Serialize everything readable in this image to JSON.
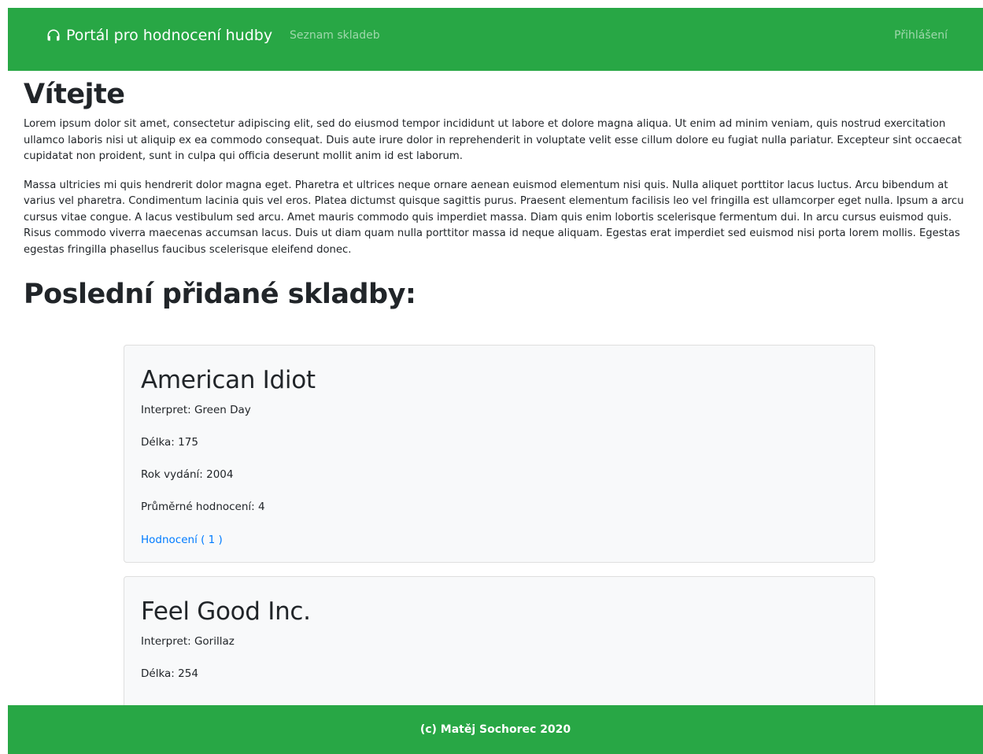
{
  "navbar": {
    "brand_text": "Portál pro hodnocení hudby",
    "brand_icon": "headphones-icon",
    "links": [
      "Seznam skladeb"
    ],
    "login": "Přihlášení",
    "color": "#28a745"
  },
  "welcome": {
    "title": "Vítejte",
    "paragraphs": [
      "Lorem ipsum dolor sit amet, consectetur adipiscing elit, sed do eiusmod tempor incididunt ut labore et dolore magna aliqua. Ut enim ad minim veniam, quis nostrud exercitation ullamco laboris nisi ut aliquip ex ea commodo consequat. Duis aute irure dolor in reprehenderit in voluptate velit esse cillum dolore eu fugiat nulla pariatur. Excepteur sint occaecat cupidatat non proident, sunt in culpa qui officia deserunt mollit anim id est laborum.",
      "Massa ultricies mi quis hendrerit dolor magna eget. Pharetra et ultrices neque ornare aenean euismod elementum nisi quis. Nulla aliquet porttitor lacus luctus. Arcu bibendum at varius vel pharetra. Condimentum lacinia quis vel eros. Platea dictumst quisque sagittis purus. Praesent elementum facilisis leo vel fringilla est ullamcorper eget nulla. Ipsum a arcu cursus vitae congue. A lacus vestibulum sed arcu. Amet mauris commodo quis imperdiet massa. Diam quis enim lobortis scelerisque fermentum dui. In arcu cursus euismod quis. Risus commodo viverra maecenas accumsan lacus. Duis ut diam quam nulla porttitor massa id neque aliquam. Egestas erat imperdiet sed euismod nisi porta lorem mollis. Egestas egestas fringilla phasellus faucibus scelerisque eleifend donec."
    ]
  },
  "latest": {
    "title": "Poslední přidané skladby:",
    "songs": [
      {
        "title": "American Idiot",
        "interpret": "Interpret: Green Day",
        "length": "Délka: 175",
        "year": "Rok vydání: 2004",
        "rating": "Průměrné hodnocení: 4",
        "ratings_link": "Hodnocení ( 1 )"
      },
      {
        "title": "Feel Good Inc.",
        "interpret": "Interpret: Gorillaz",
        "length": "Délka: 254"
      }
    ]
  },
  "footer": {
    "text": "(c) Matěj Sochorec 2020"
  },
  "colors": {
    "accent": "#28a745",
    "link": "#007bff"
  }
}
